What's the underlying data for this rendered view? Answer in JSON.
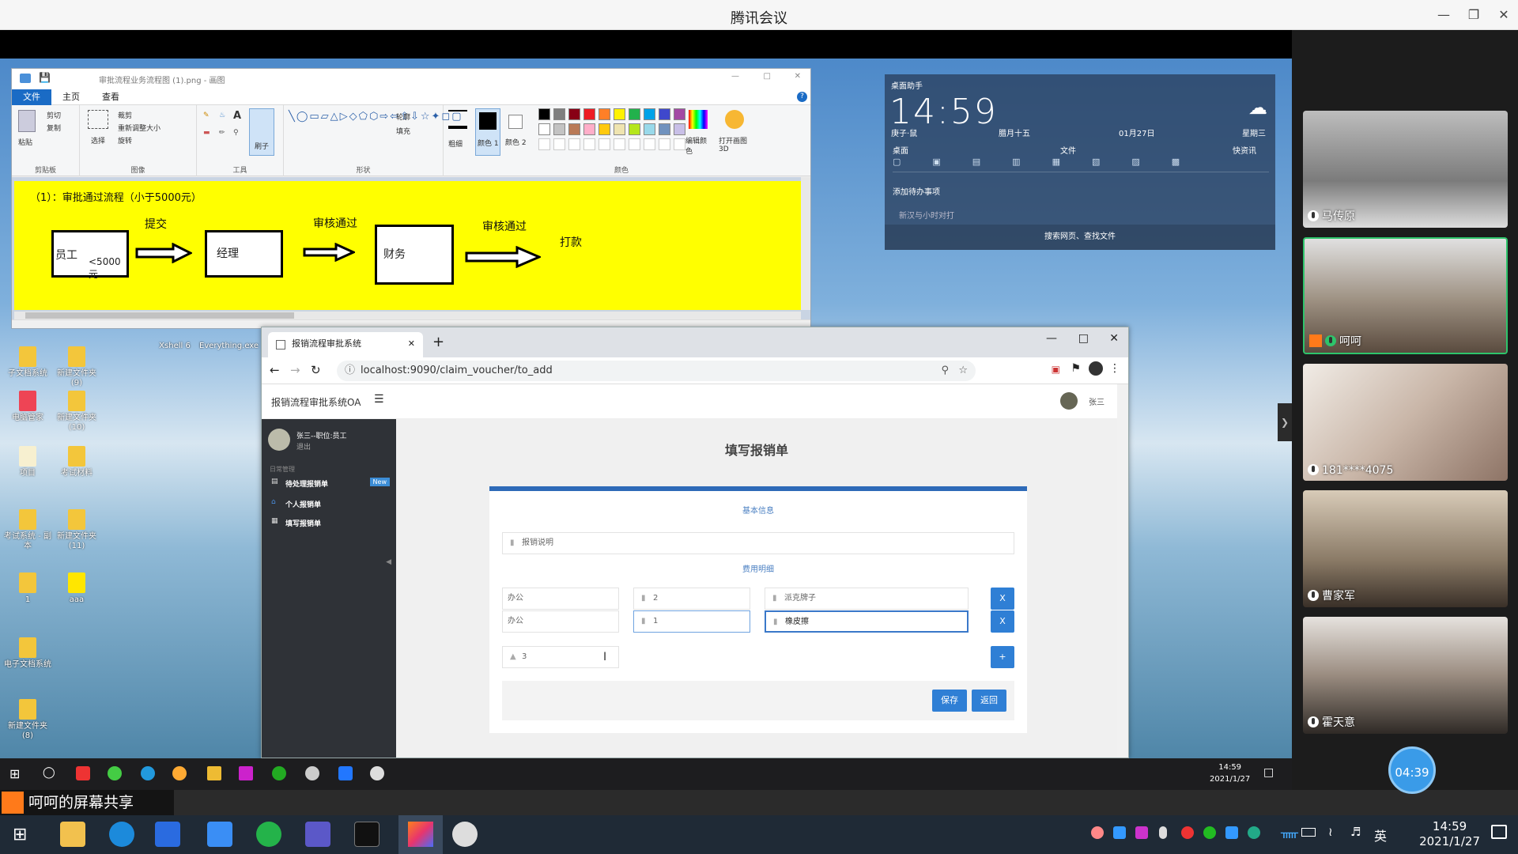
{
  "app": {
    "title": "腾讯会议"
  },
  "paint": {
    "title": "审批流程业务流程图 (1).png - 画图",
    "tabs": [
      "文件",
      "主页",
      "查看"
    ],
    "groups": [
      "剪贴板",
      "图像",
      "工具",
      "形状",
      "颜色"
    ],
    "clipboard": {
      "paste": "粘贴",
      "cut": "剪切",
      "copy": "复制"
    },
    "image": {
      "select": "选择",
      "crop": "裁剪",
      "resize": "重新调整大小",
      "rotate": "旋转"
    },
    "brushes": "刷子",
    "outline": "轮廓",
    "fill": "填充",
    "size": "粗细",
    "color1": "颜色 1",
    "color2": "颜色 2",
    "edit_colors": "编辑颜色",
    "open_3d": "打开画图 3D",
    "palette": [
      "#000000",
      "#7f7f7f",
      "#880015",
      "#ed1c24",
      "#ff7f27",
      "#fff200",
      "#22b14c",
      "#00a2e8",
      "#3f48cc",
      "#a349a4",
      "#ffffff",
      "#c3c3c3",
      "#b97a57",
      "#ffaec9",
      "#ffc90e",
      "#efe4b0",
      "#b5e61d",
      "#99d9ea",
      "#7092be",
      "#c8bfe7"
    ],
    "diagram": {
      "heading": "（1）：审批通过流程（小于5000元）",
      "box1": "员工",
      "box1_note": "<5000元",
      "box2": "经理",
      "box3": "财务",
      "arrow1": "提交",
      "arrow2": "审核通过",
      "arrow3": "审核通过",
      "end": "打款"
    }
  },
  "desktop_icons": [
    "子文档系统",
    "新建文件夹 (9)",
    "电脑管家",
    "新建文件夹 (10)",
    "项目",
    "考试材料",
    "考试系统 - 副本",
    "新建文件夹 (11)",
    "1",
    "aaa",
    "电子文档系统",
    "新建文件夹 (8)",
    "Xshell 6",
    "Everything.exe"
  ],
  "browser": {
    "tab_title": "报销流程审批系统",
    "url": "localhost:9090/claim_voucher/to_add",
    "brand": "报销流程审批系统OA",
    "user": "张三",
    "profile_name": "张三--职位:员工",
    "profile_sub": "退出",
    "nav_section": "日常管理",
    "nav": [
      {
        "label": "待处理报销单",
        "badge": "New"
      },
      {
        "label": "个人报销单"
      },
      {
        "label": "填写报销单"
      }
    ],
    "page_title": "填写报销单",
    "section_basic": "基本信息",
    "reason_placeholder": "报销说明",
    "section_detail": "费用明细",
    "rows": [
      {
        "type": "办公",
        "amount": "2",
        "desc": "派克牌子"
      },
      {
        "type": "办公",
        "amount": "1",
        "desc": "橡皮擦"
      }
    ],
    "total": "3",
    "remove_label": "X",
    "add_label": "+",
    "save_label": "保存",
    "back_label": "返回"
  },
  "widget": {
    "title": "桌面助手",
    "time": "14:59",
    "lunar_year": "庚子·鼠",
    "lunar_day": "腊月十五",
    "date": "01月27日",
    "weekday": "星期三",
    "desktop_btn": "桌面",
    "file_btn": "文件",
    "quick_btn": "快资讯",
    "todo": "添加待办事项",
    "reminder": "新汉与小时对打",
    "search": "搜索网页、查找文件"
  },
  "inner_clock": {
    "time": "14:59",
    "date": "2021/1/27"
  },
  "participants": [
    {
      "name": "马传原"
    },
    {
      "name": "呵呵"
    },
    {
      "name": "181****4075"
    },
    {
      "name": "曹家军"
    },
    {
      "name": "霍天意"
    }
  ],
  "timer": "04:39",
  "share_banner": "呵呵的屏幕共享",
  "taskbar": {
    "time": "14:59",
    "date": "2021/1/27",
    "ime": "英"
  }
}
